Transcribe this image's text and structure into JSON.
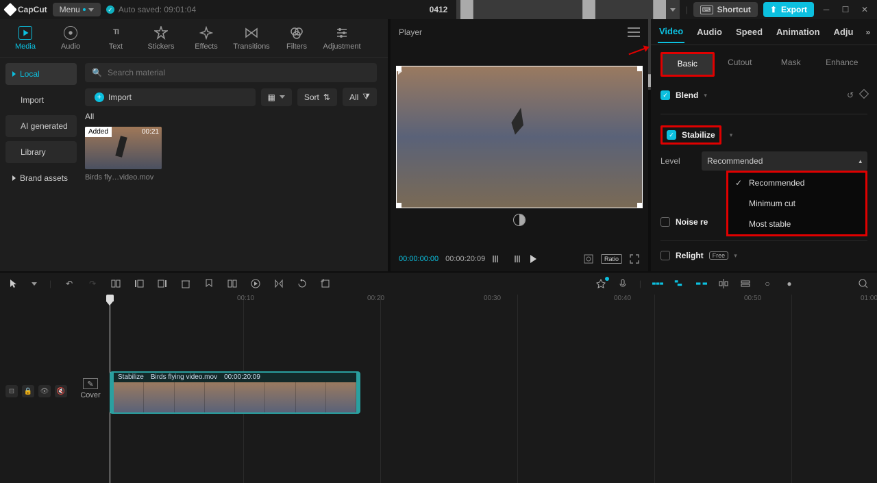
{
  "app": {
    "name": "CapCut",
    "menu": "Menu",
    "autosave": "Auto saved: 09:01:04",
    "title": "0412"
  },
  "titlebar": {
    "shortcut": "Shortcut",
    "export": "Export"
  },
  "tool_tabs": [
    {
      "label": "Media",
      "active": true
    },
    {
      "label": "Audio"
    },
    {
      "label": "Text"
    },
    {
      "label": "Stickers"
    },
    {
      "label": "Effects"
    },
    {
      "label": "Transitions"
    },
    {
      "label": "Filters"
    },
    {
      "label": "Adjustment"
    }
  ],
  "library_side": {
    "local": "Local",
    "import": "Import",
    "ai": "AI generated",
    "library": "Library",
    "brand": "Brand assets"
  },
  "search": {
    "placeholder": "Search material"
  },
  "import_btn": "Import",
  "sort_label": "Sort",
  "all_small": "All",
  "all_label": "All",
  "clip": {
    "added": "Added",
    "duration": "00:21",
    "name": "Birds fly…video.mov"
  },
  "player": {
    "title": "Player",
    "time_current": "00:00:00:00",
    "time_total": "00:00:20:09",
    "ratio": "Ratio"
  },
  "inspect_tabs": {
    "video": "Video",
    "audio": "Audio",
    "speed": "Speed",
    "animation": "Animation",
    "adjust": "Adju"
  },
  "sub_tabs": {
    "basic": "Basic",
    "cutout": "Cutout",
    "mask": "Mask",
    "enhance": "Enhance"
  },
  "sections": {
    "blend": "Blend",
    "stabilize": "Stabilize",
    "level": "Level",
    "level_value": "Recommended",
    "noise": "Noise re",
    "relight": "Relight",
    "free": "Free",
    "options": {
      "recommended": "Recommended",
      "minimum": "Minimum cut",
      "most_stable": "Most stable"
    }
  },
  "timeline": {
    "cover": "Cover",
    "ruler": [
      "00:10",
      "00:20",
      "00:30",
      "00:40",
      "00:50",
      "01:00"
    ],
    "clip": {
      "tag": "Stabilize",
      "name": "Birds flying video.mov",
      "dur": "00:00:20:09"
    }
  }
}
